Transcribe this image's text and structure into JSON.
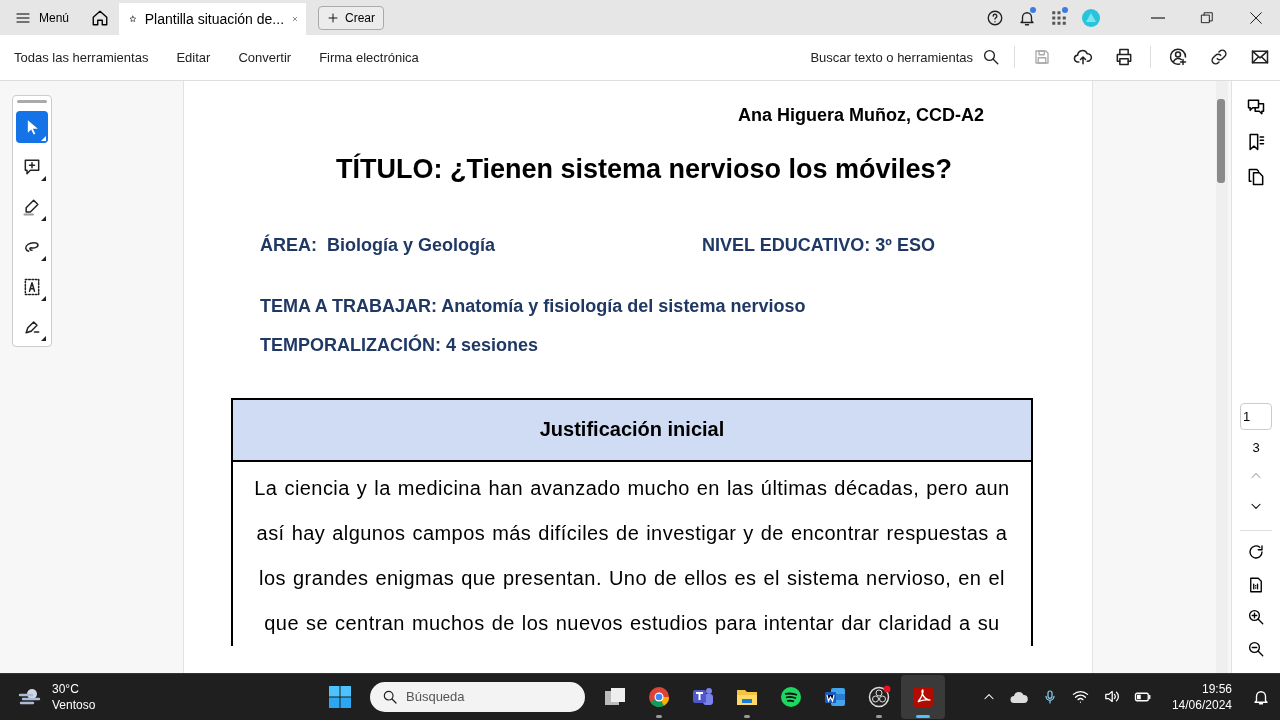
{
  "titlebar": {
    "menu": "Menú",
    "tab": {
      "title": "Plantilla situación de...",
      "selected": true
    },
    "create": "Crear"
  },
  "toolbar": {
    "items": [
      "Todas las herramientas",
      "Editar",
      "Convertir",
      "Firma electrónica"
    ],
    "search": "Buscar texto o herramientas"
  },
  "tools": [
    {
      "kind": "select",
      "selected": true
    },
    {
      "kind": "comment",
      "selected": false
    },
    {
      "kind": "highlight",
      "selected": false
    },
    {
      "kind": "lasso",
      "selected": false
    },
    {
      "kind": "textbox",
      "selected": false
    },
    {
      "kind": "sign",
      "selected": false
    }
  ],
  "document": {
    "author": "Ana Higuera Muñoz, CCD-A2",
    "title": "TÍTULO: ¿Tienen sistema nervioso los móviles?",
    "area": "ÁREA:  Biología y Geología",
    "level": "NIVEL EDUCATIVO: 3º ESO",
    "topic": "TEMA A TRABAJAR: Anatomía y fisiología del sistema nervioso",
    "timing": "TEMPORALIZACIÓN: 4 sesiones",
    "table": {
      "header": "Justificación inicial",
      "body": "La ciencia y la medicina han avanzado mucho en las últimas décadas, pero aun así hay algunos campos más difíciles de investigar y de encontrar respuestas a los grandes enigmas que presentan. Uno de ellos es el sistema nervioso, en el que se centran muchos de los nuevos estudios para intentar dar claridad a su"
    }
  },
  "page_nav": {
    "current": "1",
    "total": "3"
  },
  "taskbar": {
    "weather": {
      "temp": "30°C",
      "condition": "Ventoso"
    },
    "search_placeholder": "Búsqueda",
    "apps": [
      {
        "kind": "taskview",
        "running": false,
        "active": false
      },
      {
        "kind": "chrome",
        "running": true,
        "active": false
      },
      {
        "kind": "teams",
        "running": false,
        "active": false
      },
      {
        "kind": "explorer",
        "running": true,
        "active": false
      },
      {
        "kind": "spotify",
        "running": false,
        "active": false
      },
      {
        "kind": "word",
        "running": false,
        "active": false
      },
      {
        "kind": "obs",
        "running": true,
        "active": false
      },
      {
        "kind": "acrobat",
        "running": true,
        "active": true
      }
    ],
    "time": "19:56",
    "date": "14/06/2024"
  }
}
